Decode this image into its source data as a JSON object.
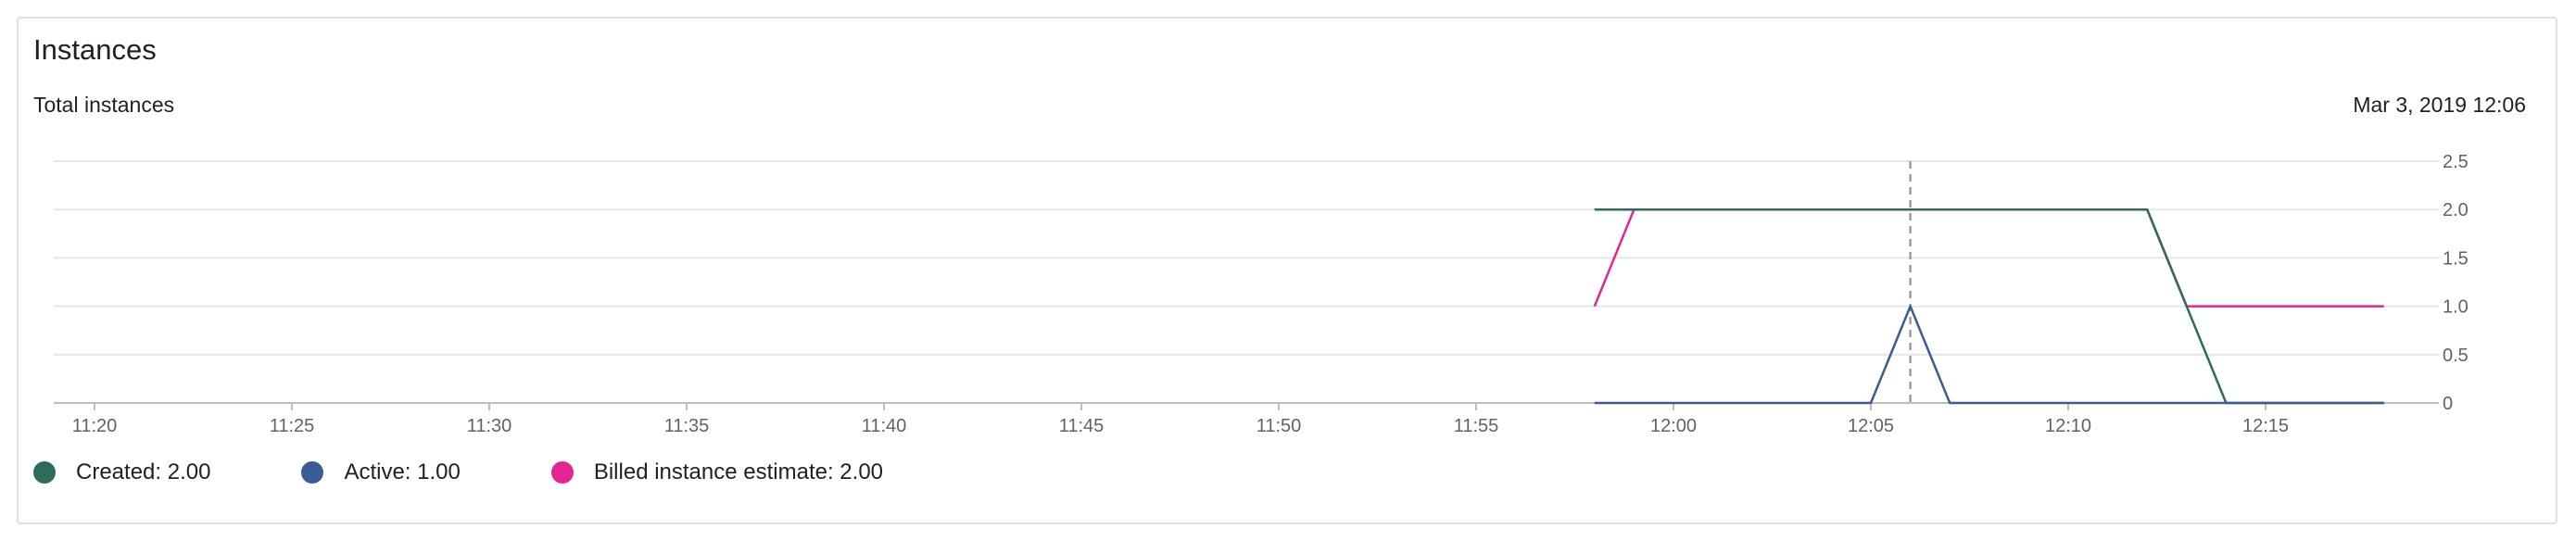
{
  "panel": {
    "title": "Instances",
    "subtitle": "Total instances",
    "timestamp": "Mar 3, 2019 12:06"
  },
  "legend": [
    {
      "label": "Created: 2.00",
      "color": "#2e6b5e"
    },
    {
      "label": "Active: 1.00",
      "color": "#3b5b95"
    },
    {
      "label": "Billed instance estimate: 2.00",
      "color": "#e52592"
    }
  ],
  "chart_data": {
    "type": "line",
    "title": "Total instances",
    "xlabel": "",
    "ylabel": "",
    "x_ticks": [
      "11:20",
      "11:25",
      "11:30",
      "11:35",
      "11:40",
      "11:45",
      "11:50",
      "11:55",
      "12:00",
      "12:05",
      "12:10",
      "12:15"
    ],
    "y_ticks": [
      "0",
      "0.5",
      "1.0",
      "1.5",
      "2.0",
      "2.5"
    ],
    "xlim": [
      "11:19",
      "11:20"
    ],
    "ylim": [
      0,
      2.5
    ],
    "grid": true,
    "cursor_time": "12:06",
    "series": [
      {
        "name": "Billed instance estimate",
        "color": "#e52592",
        "points": [
          [
            "11:58",
            1.0
          ],
          [
            "11:59",
            2.0
          ],
          [
            "12:12",
            2.0
          ],
          [
            "12:13",
            1.0
          ],
          [
            "12:18",
            1.0
          ]
        ]
      },
      {
        "name": "Created",
        "color": "#2e6b5e",
        "points": [
          [
            "11:58",
            2.0
          ],
          [
            "12:12",
            2.0
          ],
          [
            "12:14",
            0
          ],
          [
            "12:18",
            0
          ]
        ]
      },
      {
        "name": "Active",
        "color": "#3b5b95",
        "points": [
          [
            "11:58",
            0
          ],
          [
            "12:05",
            0
          ],
          [
            "12:06",
            1.0
          ],
          [
            "12:07",
            0
          ],
          [
            "12:18",
            0
          ]
        ]
      }
    ]
  }
}
